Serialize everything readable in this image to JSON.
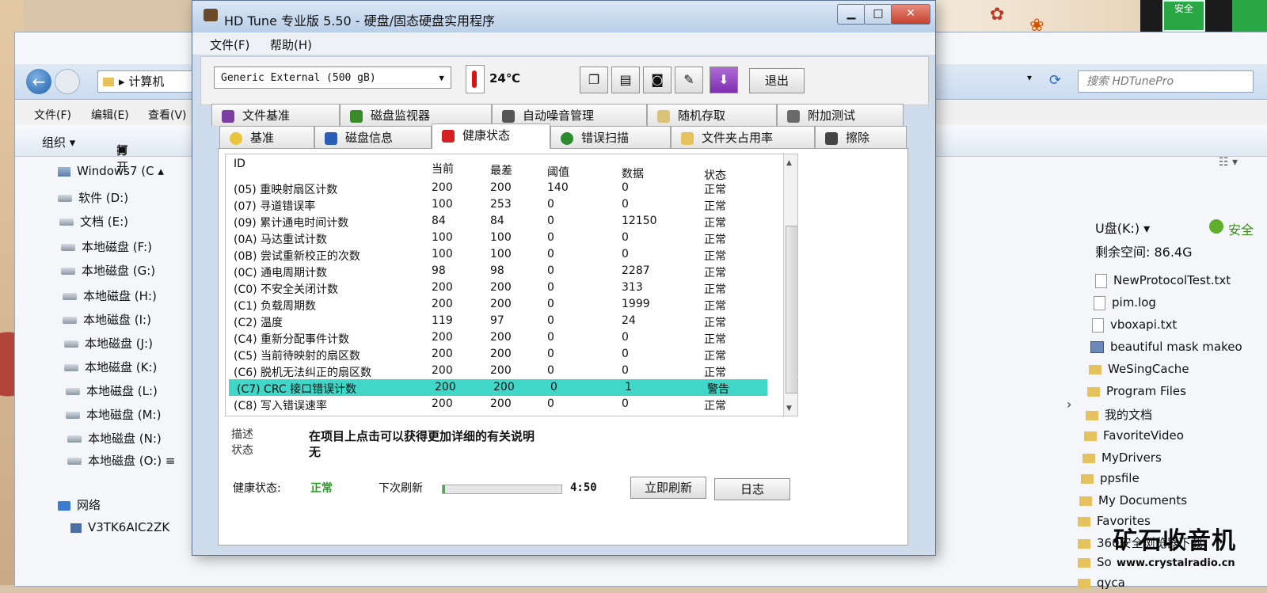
{
  "explorer": {
    "address": "计算机",
    "search_placeholder": "搜索 HDTunePro",
    "menu": [
      "文件(F)",
      "编辑(E)",
      "查看(V)"
    ],
    "cmd": {
      "organize": "组织 ▾",
      "open": "打开"
    },
    "tree": [
      {
        "label": "Windows7 (C",
        "icon": "windows-drive-icon"
      },
      {
        "label": "软件 (D:)",
        "icon": "drive-icon"
      },
      {
        "label": "文档 (E:)",
        "icon": "drive-icon"
      },
      {
        "label": "本地磁盘 (F:)",
        "icon": "drive-icon"
      },
      {
        "label": "本地磁盘 (G:)",
        "icon": "drive-icon"
      },
      {
        "label": "本地磁盘 (H:)",
        "icon": "drive-icon"
      },
      {
        "label": "本地磁盘 (I:)",
        "icon": "drive-icon"
      },
      {
        "label": "本地磁盘 (J:)",
        "icon": "drive-icon"
      },
      {
        "label": "本地磁盘 (K:)",
        "icon": "drive-icon"
      },
      {
        "label": "本地磁盘 (L:)",
        "icon": "drive-icon"
      },
      {
        "label": "本地磁盘 (M:)",
        "icon": "drive-icon"
      },
      {
        "label": "本地磁盘 (N:)",
        "icon": "drive-icon"
      },
      {
        "label": "本地磁盘 (O:)",
        "icon": "drive-icon"
      }
    ],
    "network": "网络",
    "computer": "V3TK6AIC2ZK",
    "usb_label": "U盘(K:) ▾",
    "free_space": "剩余空间: 86.4G",
    "safe_label": "安全",
    "files": [
      {
        "name": "NewProtocolTest.txt",
        "icon": "file-icon"
      },
      {
        "name": "pim.log",
        "icon": "file-icon"
      },
      {
        "name": "vboxapi.txt",
        "icon": "file-icon"
      },
      {
        "name": "beautiful mask makeo",
        "icon": "image-icon"
      },
      {
        "name": "WeSingCache",
        "icon": "folder-icon"
      },
      {
        "name": "Program Files",
        "icon": "folder-icon"
      },
      {
        "name": "我的文档",
        "icon": "folder-icon"
      },
      {
        "name": "FavoriteVideo",
        "icon": "folder-icon"
      },
      {
        "name": "MyDrivers",
        "icon": "folder-icon"
      },
      {
        "name": "ppsfile",
        "icon": "folder-icon"
      },
      {
        "name": "My Documents",
        "icon": "folder-icon"
      },
      {
        "name": "Favorites",
        "icon": "folder-icon"
      },
      {
        "name": "360安全浏览器下载",
        "icon": "folder-icon"
      },
      {
        "name": "So",
        "icon": "folder-icon"
      },
      {
        "name": "qyca",
        "icon": "folder-icon"
      }
    ]
  },
  "watermark": {
    "title": "矿石收音机",
    "url": "www.crystalradio.cn"
  },
  "corner_widget": {
    "button_label": "安全"
  },
  "hdtune": {
    "title": "HD Tune 专业版 5.50 - 硬盘/固态硬盘实用程序",
    "menu": {
      "file": "文件(F)",
      "help": "帮助(H)"
    },
    "drive": "Generic External (500 gB)",
    "temperature": "24℃",
    "exit_label": "退出",
    "tabs_top": [
      "文件基准",
      "磁盘监视器",
      "自动噪音管理",
      "随机存取",
      "附加测试"
    ],
    "tabs_bottom": [
      "基准",
      "磁盘信息",
      "健康状态",
      "错误扫描",
      "文件夹占用率",
      "擦除"
    ],
    "active_tab": "健康状态",
    "columns": {
      "id": "ID",
      "current": "当前",
      "worst": "最差",
      "threshold": "阈值",
      "data": "数据",
      "status": "状态"
    },
    "rows": [
      {
        "id": "(05) 重映射扇区计数",
        "cur": "200",
        "worst": "200",
        "thr": "140",
        "data": "0",
        "status": "正常"
      },
      {
        "id": "(07) 寻道错误率",
        "cur": "100",
        "worst": "253",
        "thr": "0",
        "data": "0",
        "status": "正常"
      },
      {
        "id": "(09) 累计通电时间计数",
        "cur": "84",
        "worst": "84",
        "thr": "0",
        "data": "12150",
        "status": "正常"
      },
      {
        "id": "(0A) 马达重试计数",
        "cur": "100",
        "worst": "100",
        "thr": "0",
        "data": "0",
        "status": "正常"
      },
      {
        "id": "(0B) 尝试重新校正的次数",
        "cur": "100",
        "worst": "100",
        "thr": "0",
        "data": "0",
        "status": "正常"
      },
      {
        "id": "(0C) 通电周期计数",
        "cur": "98",
        "worst": "98",
        "thr": "0",
        "data": "2287",
        "status": "正常"
      },
      {
        "id": "(C0) 不安全关闭计数",
        "cur": "200",
        "worst": "200",
        "thr": "0",
        "data": "313",
        "status": "正常"
      },
      {
        "id": "(C1) 负载周期数",
        "cur": "200",
        "worst": "200",
        "thr": "0",
        "data": "1999",
        "status": "正常"
      },
      {
        "id": "(C2) 温度",
        "cur": "119",
        "worst": "97",
        "thr": "0",
        "data": "24",
        "status": "正常"
      },
      {
        "id": "(C4) 重新分配事件计数",
        "cur": "200",
        "worst": "200",
        "thr": "0",
        "data": "0",
        "status": "正常"
      },
      {
        "id": "(C5) 当前待映射的扇区数",
        "cur": "200",
        "worst": "200",
        "thr": "0",
        "data": "0",
        "status": "正常"
      },
      {
        "id": "(C6) 脱机无法纠正的扇区数",
        "cur": "200",
        "worst": "200",
        "thr": "0",
        "data": "0",
        "status": "正常"
      },
      {
        "id": "(C7) CRC 接口错误计数",
        "cur": "200",
        "worst": "200",
        "thr": "0",
        "data": "1",
        "status": "警告"
      },
      {
        "id": "(C8) 写入错误速率",
        "cur": "200",
        "worst": "200",
        "thr": "0",
        "data": "0",
        "status": "正常"
      }
    ],
    "desc_label": "描述",
    "desc_value": "在项目上点击可以获得更加详细的有关说明",
    "status_label": "状态",
    "status_value": "无",
    "health_label": "健康状态:",
    "health_value": "正常",
    "next_refresh_label": "下次刷新",
    "refresh_progress": 0.02,
    "countdown": "4:50",
    "refresh_button": "立即刷新",
    "log_button": "日志",
    "colors": {
      "warning_row": "#40d6c8",
      "health_ok": "#22a022"
    }
  }
}
